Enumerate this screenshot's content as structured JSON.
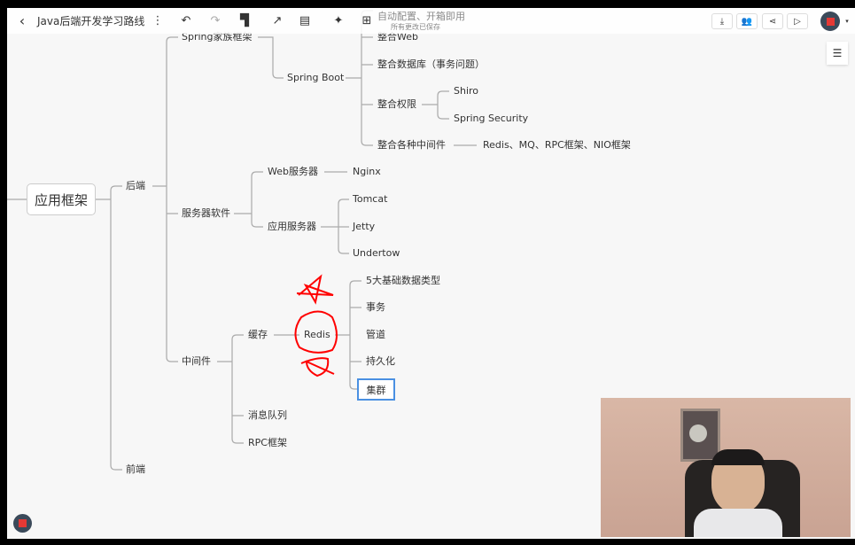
{
  "toolbar": {
    "back_icon": "chevron-left-icon",
    "title": "Java后端开发学习路线",
    "more_icon": "vertical-dots-icon",
    "undo_icon": "undo-icon",
    "redo_icon": "redo-icon",
    "format_painter_icon": "paint-roller-icon",
    "connector_icon": "arrow-icon",
    "summary_icon": "summary-icon",
    "magic_icon": "sparkle-icon",
    "structure_icon": "layout-icon",
    "save_status": "所有更改已保存",
    "download_icon": "download-icon",
    "collab_icon": "users-icon",
    "share_icon": "share-icon",
    "present_icon": "play-icon",
    "avatar_icon": "avatar-icon",
    "avatar_color": "#3b4a5a",
    "avatar_accent": "#e53935"
  },
  "side_panel": {
    "settings_icon": "sliders-icon"
  },
  "mindmap": {
    "root": "应用框架",
    "backend": "后端",
    "frontend": "前端",
    "spring_family": "Spring家族框架",
    "auto_config": "自动配置、开箱即用",
    "spring_boot": "Spring Boot",
    "integrate_web": "整合Web",
    "integrate_db": "整合数据库（事务问题）",
    "integrate_auth": "整合权限",
    "shiro": "Shiro",
    "spring_security": "Spring Security",
    "integrate_middleware": "整合各种中间件",
    "middleware_list": "Redis、MQ、RPC框架、NIO框架",
    "server_software": "服务器软件",
    "web_server": "Web服务器",
    "nginx": "Nginx",
    "app_server": "应用服务器",
    "tomcat": "Tomcat",
    "jetty": "Jetty",
    "undertow": "Undertow",
    "middleware": "中间件",
    "cache": "缓存",
    "redis": "Redis",
    "redis_children": [
      "5大基础数据类型",
      "事务",
      "管道",
      "持久化",
      "集群"
    ],
    "mq": "消息队列",
    "rpc": "RPC框架",
    "selected_node": "集群",
    "selection_color": "#4a90e2",
    "annotation_color": "#ff0000"
  }
}
